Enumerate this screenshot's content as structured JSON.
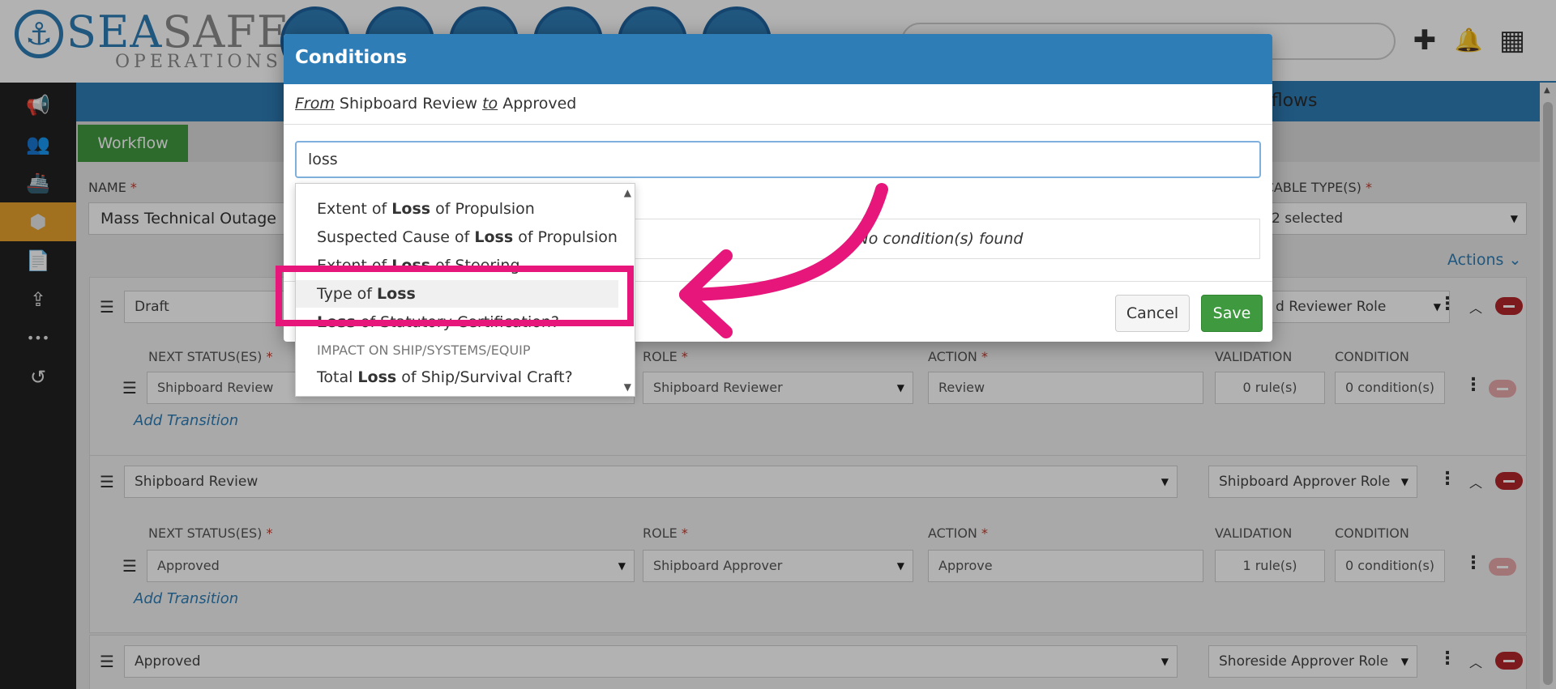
{
  "header": {
    "logo_primary_a": "SEA",
    "logo_primary_b": "SAFE",
    "logo_secondary": "OPERATIONS",
    "anchor_glyph": "⚓",
    "top_icons": [
      "plus-icon",
      "bell-icon",
      "apps-grid-icon"
    ],
    "plus_glyph": "✚",
    "bell_glyph": "🔔",
    "grid_glyph": "▦"
  },
  "sidebar": {
    "items": [
      {
        "icon": "megaphone-icon",
        "glyph": "📢"
      },
      {
        "icon": "users-icon",
        "glyph": "👥"
      },
      {
        "icon": "ship-icon",
        "glyph": "🚢"
      },
      {
        "icon": "cubes-icon",
        "glyph": "⬢"
      },
      {
        "icon": "document-icon",
        "glyph": "📄"
      },
      {
        "icon": "upload-icon",
        "glyph": "⇪"
      },
      {
        "icon": "more-icon",
        "glyph": "•••"
      },
      {
        "icon": "history-icon",
        "glyph": "↺"
      }
    ]
  },
  "page": {
    "title_fragment": "kflows",
    "tab_label": "Workflow",
    "name_label": "NAME",
    "name_value": "Mass Technical Outage",
    "applicable_label": "ICABLE TYPE(S)",
    "applicable_value": "2 selected",
    "actions_label": "Actions",
    "required_mark": "*"
  },
  "statuses": [
    {
      "name": "Draft",
      "role": "d Reviewer Role",
      "transition": {
        "next_status_label": "NEXT STATUS(ES)",
        "next_status": "Shipboard Review",
        "role_label": "ROLE",
        "role": "Shipboard Reviewer",
        "action_label": "ACTION",
        "action": "Review",
        "validation_label": "VALIDATION",
        "validation": "0 rule(s)",
        "condition_label": "CONDITION",
        "condition": "0 condition(s)"
      },
      "add_transition": "Add Transition"
    },
    {
      "name": "Shipboard Review",
      "role": "Shipboard Approver Role",
      "transition": {
        "next_status_label": "NEXT STATUS(ES)",
        "next_status": "Approved",
        "role_label": "ROLE",
        "role": "Shipboard Approver",
        "action_label": "ACTION",
        "action": "Approve",
        "validation_label": "VALIDATION",
        "validation": "1 rule(s)",
        "condition_label": "CONDITION",
        "condition": "0 condition(s)"
      },
      "add_transition": "Add Transition"
    },
    {
      "name": "Approved",
      "role": "Shoreside Approver Role"
    }
  ],
  "modal": {
    "title": "Conditions",
    "from_label": "From",
    "from_value": "Shipboard Review",
    "to_label": "to",
    "to_value": "Approved",
    "search_value": "loss",
    "no_conditions": "No condition(s) found",
    "cancel_label": "Cancel",
    "save_label": "Save"
  },
  "dropdown": {
    "items": [
      {
        "pre": "Extent of ",
        "match": "Loss",
        "post": " of Propulsion"
      },
      {
        "pre": "Suspected Cause of ",
        "match": "Loss",
        "post": " of Propulsion"
      },
      {
        "pre": "Extent of ",
        "match": "Loss",
        "post": " of Steering"
      },
      {
        "pre": "Type of ",
        "match": "Loss",
        "post": ""
      },
      {
        "pre": "",
        "match": "Loss",
        "post": " of Statutory Certification?"
      }
    ],
    "group_label": "IMPACT ON SHIP/SYSTEMS/EQUIP",
    "group_items": [
      {
        "pre": "Total ",
        "match": "Loss",
        "post": " of Ship/Survival Craft?"
      }
    ],
    "highlighted_index": 3
  },
  "colors": {
    "brand_blue": "#2e7db6",
    "success_green": "#3f9a3f",
    "danger_red": "#b3262a",
    "sidebar_active": "#e7a22e",
    "annotation_pink": "#e6167a"
  }
}
